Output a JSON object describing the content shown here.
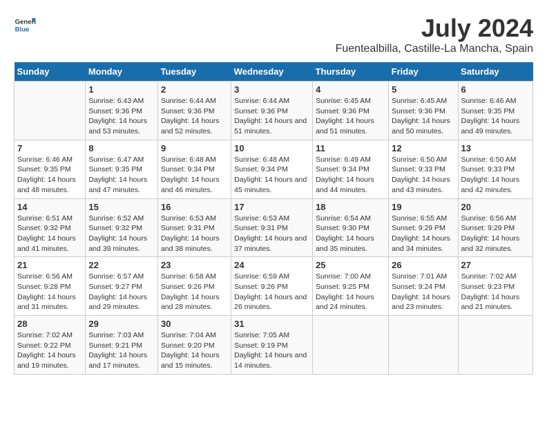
{
  "header": {
    "logo_general": "General",
    "logo_blue": "Blue",
    "title": "July 2024",
    "subtitle": "Fuentealbilla, Castille-La Mancha, Spain"
  },
  "calendar": {
    "days_of_week": [
      "Sunday",
      "Monday",
      "Tuesday",
      "Wednesday",
      "Thursday",
      "Friday",
      "Saturday"
    ],
    "weeks": [
      [
        {
          "day": "",
          "sunrise": "",
          "sunset": "",
          "daylight": ""
        },
        {
          "day": "1",
          "sunrise": "Sunrise: 6:43 AM",
          "sunset": "Sunset: 9:36 PM",
          "daylight": "Daylight: 14 hours and 53 minutes."
        },
        {
          "day": "2",
          "sunrise": "Sunrise: 6:44 AM",
          "sunset": "Sunset: 9:36 PM",
          "daylight": "Daylight: 14 hours and 52 minutes."
        },
        {
          "day": "3",
          "sunrise": "Sunrise: 6:44 AM",
          "sunset": "Sunset: 9:36 PM",
          "daylight": "Daylight: 14 hours and 51 minutes."
        },
        {
          "day": "4",
          "sunrise": "Sunrise: 6:45 AM",
          "sunset": "Sunset: 9:36 PM",
          "daylight": "Daylight: 14 hours and 51 minutes."
        },
        {
          "day": "5",
          "sunrise": "Sunrise: 6:45 AM",
          "sunset": "Sunset: 9:36 PM",
          "daylight": "Daylight: 14 hours and 50 minutes."
        },
        {
          "day": "6",
          "sunrise": "Sunrise: 6:46 AM",
          "sunset": "Sunset: 9:35 PM",
          "daylight": "Daylight: 14 hours and 49 minutes."
        }
      ],
      [
        {
          "day": "7",
          "sunrise": "Sunrise: 6:46 AM",
          "sunset": "Sunset: 9:35 PM",
          "daylight": "Daylight: 14 hours and 48 minutes."
        },
        {
          "day": "8",
          "sunrise": "Sunrise: 6:47 AM",
          "sunset": "Sunset: 9:35 PM",
          "daylight": "Daylight: 14 hours and 47 minutes."
        },
        {
          "day": "9",
          "sunrise": "Sunrise: 6:48 AM",
          "sunset": "Sunset: 9:34 PM",
          "daylight": "Daylight: 14 hours and 46 minutes."
        },
        {
          "day": "10",
          "sunrise": "Sunrise: 6:48 AM",
          "sunset": "Sunset: 9:34 PM",
          "daylight": "Daylight: 14 hours and 45 minutes."
        },
        {
          "day": "11",
          "sunrise": "Sunrise: 6:49 AM",
          "sunset": "Sunset: 9:34 PM",
          "daylight": "Daylight: 14 hours and 44 minutes."
        },
        {
          "day": "12",
          "sunrise": "Sunrise: 6:50 AM",
          "sunset": "Sunset: 9:33 PM",
          "daylight": "Daylight: 14 hours and 43 minutes."
        },
        {
          "day": "13",
          "sunrise": "Sunrise: 6:50 AM",
          "sunset": "Sunset: 9:33 PM",
          "daylight": "Daylight: 14 hours and 42 minutes."
        }
      ],
      [
        {
          "day": "14",
          "sunrise": "Sunrise: 6:51 AM",
          "sunset": "Sunset: 9:32 PM",
          "daylight": "Daylight: 14 hours and 41 minutes."
        },
        {
          "day": "15",
          "sunrise": "Sunrise: 6:52 AM",
          "sunset": "Sunset: 9:32 PM",
          "daylight": "Daylight: 14 hours and 39 minutes."
        },
        {
          "day": "16",
          "sunrise": "Sunrise: 6:53 AM",
          "sunset": "Sunset: 9:31 PM",
          "daylight": "Daylight: 14 hours and 38 minutes."
        },
        {
          "day": "17",
          "sunrise": "Sunrise: 6:53 AM",
          "sunset": "Sunset: 9:31 PM",
          "daylight": "Daylight: 14 hours and 37 minutes."
        },
        {
          "day": "18",
          "sunrise": "Sunrise: 6:54 AM",
          "sunset": "Sunset: 9:30 PM",
          "daylight": "Daylight: 14 hours and 35 minutes."
        },
        {
          "day": "19",
          "sunrise": "Sunrise: 6:55 AM",
          "sunset": "Sunset: 9:29 PM",
          "daylight": "Daylight: 14 hours and 34 minutes."
        },
        {
          "day": "20",
          "sunrise": "Sunrise: 6:56 AM",
          "sunset": "Sunset: 9:29 PM",
          "daylight": "Daylight: 14 hours and 32 minutes."
        }
      ],
      [
        {
          "day": "21",
          "sunrise": "Sunrise: 6:56 AM",
          "sunset": "Sunset: 9:28 PM",
          "daylight": "Daylight: 14 hours and 31 minutes."
        },
        {
          "day": "22",
          "sunrise": "Sunrise: 6:57 AM",
          "sunset": "Sunset: 9:27 PM",
          "daylight": "Daylight: 14 hours and 29 minutes."
        },
        {
          "day": "23",
          "sunrise": "Sunrise: 6:58 AM",
          "sunset": "Sunset: 9:26 PM",
          "daylight": "Daylight: 14 hours and 28 minutes."
        },
        {
          "day": "24",
          "sunrise": "Sunrise: 6:59 AM",
          "sunset": "Sunset: 9:26 PM",
          "daylight": "Daylight: 14 hours and 26 minutes."
        },
        {
          "day": "25",
          "sunrise": "Sunrise: 7:00 AM",
          "sunset": "Sunset: 9:25 PM",
          "daylight": "Daylight: 14 hours and 24 minutes."
        },
        {
          "day": "26",
          "sunrise": "Sunrise: 7:01 AM",
          "sunset": "Sunset: 9:24 PM",
          "daylight": "Daylight: 14 hours and 23 minutes."
        },
        {
          "day": "27",
          "sunrise": "Sunrise: 7:02 AM",
          "sunset": "Sunset: 9:23 PM",
          "daylight": "Daylight: 14 hours and 21 minutes."
        }
      ],
      [
        {
          "day": "28",
          "sunrise": "Sunrise: 7:02 AM",
          "sunset": "Sunset: 9:22 PM",
          "daylight": "Daylight: 14 hours and 19 minutes."
        },
        {
          "day": "29",
          "sunrise": "Sunrise: 7:03 AM",
          "sunset": "Sunset: 9:21 PM",
          "daylight": "Daylight: 14 hours and 17 minutes."
        },
        {
          "day": "30",
          "sunrise": "Sunrise: 7:04 AM",
          "sunset": "Sunset: 9:20 PM",
          "daylight": "Daylight: 14 hours and 15 minutes."
        },
        {
          "day": "31",
          "sunrise": "Sunrise: 7:05 AM",
          "sunset": "Sunset: 9:19 PM",
          "daylight": "Daylight: 14 hours and 14 minutes."
        },
        {
          "day": "",
          "sunrise": "",
          "sunset": "",
          "daylight": ""
        },
        {
          "day": "",
          "sunrise": "",
          "sunset": "",
          "daylight": ""
        },
        {
          "day": "",
          "sunrise": "",
          "sunset": "",
          "daylight": ""
        }
      ]
    ]
  }
}
